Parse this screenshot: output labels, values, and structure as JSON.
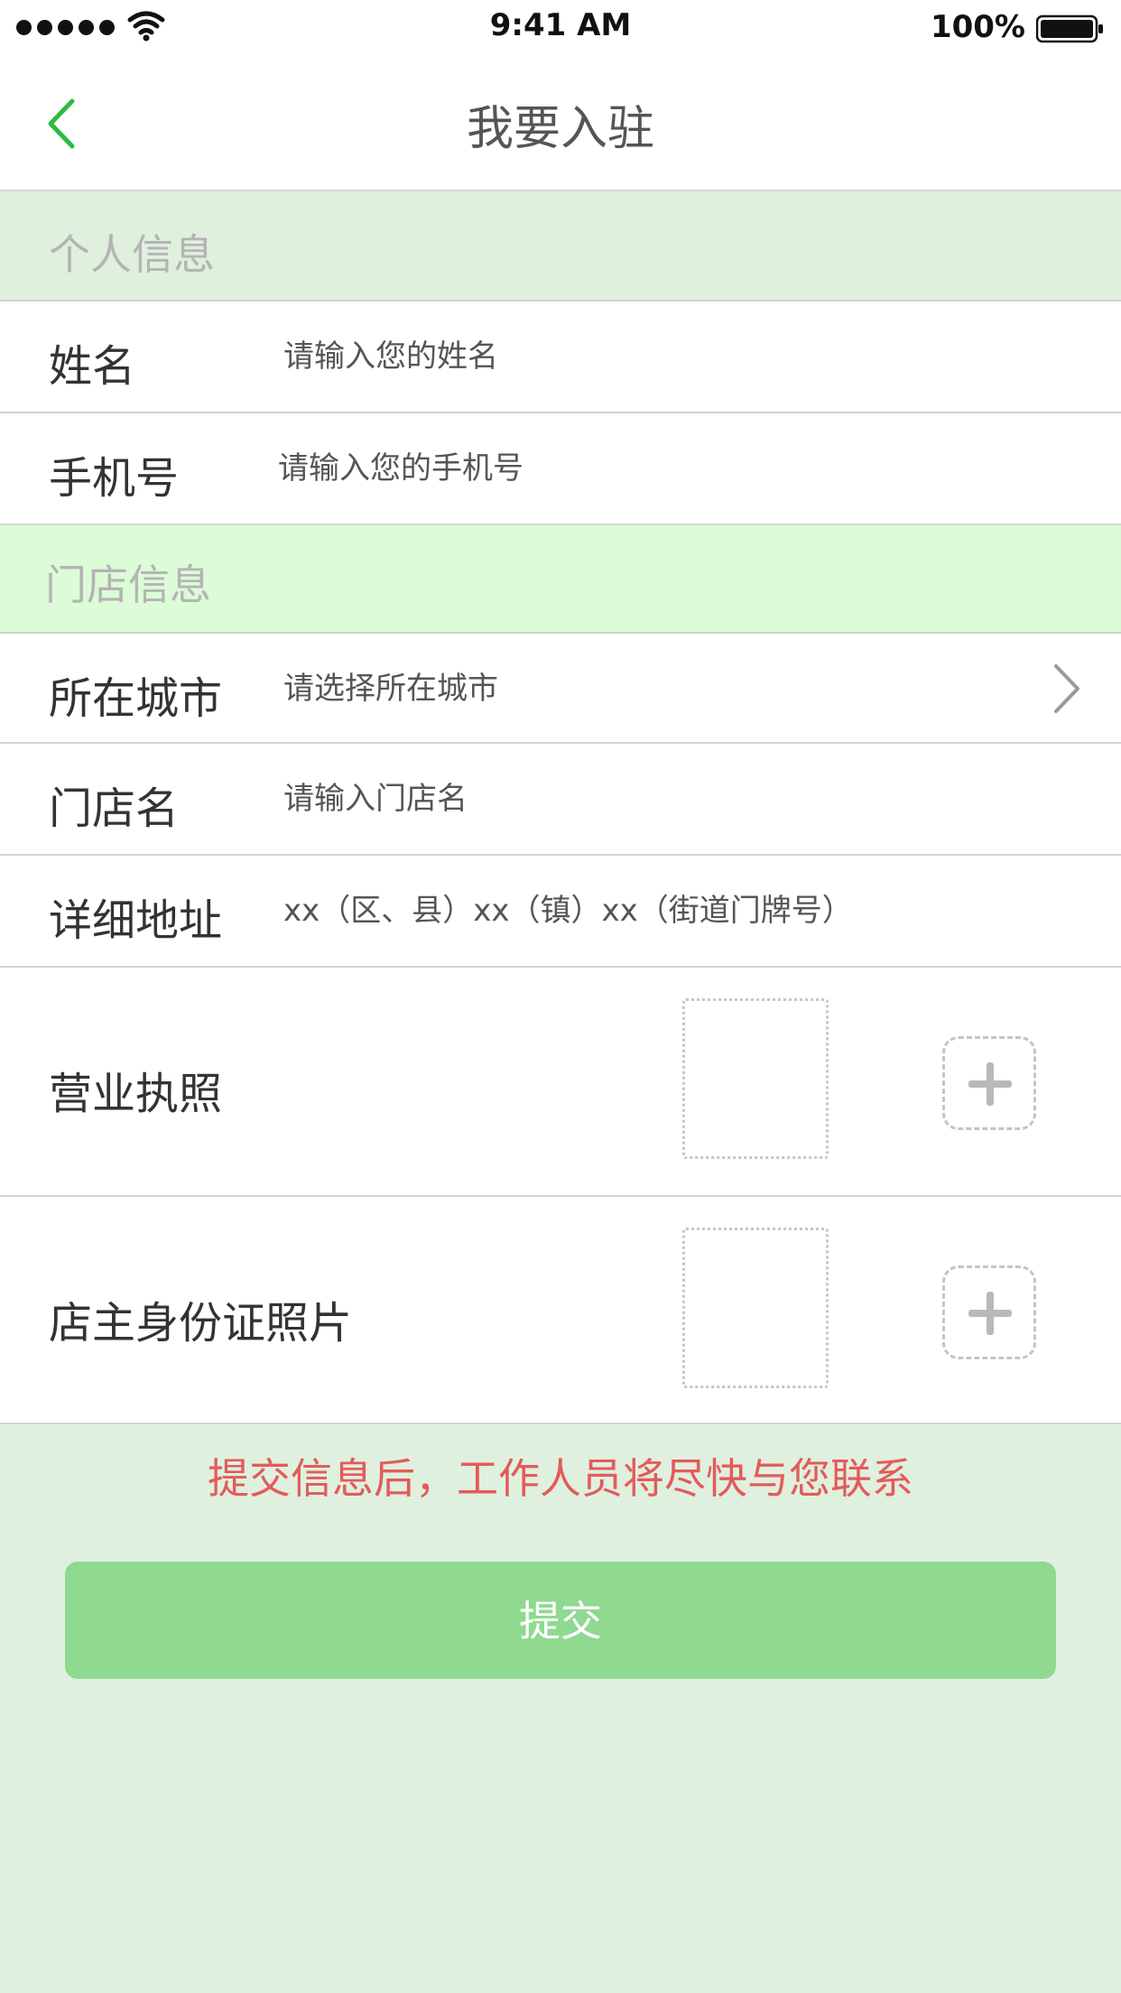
{
  "status_bar": {
    "time": "9:41 AM",
    "battery": "100%",
    "icons": [
      "signal-dots",
      "wifi-icon",
      "battery-icon"
    ]
  },
  "nav": {
    "title": "我要入驻",
    "back_icon": "chevron-left-icon"
  },
  "sections": {
    "personal": "个人信息",
    "store": "门店信息"
  },
  "form": {
    "name": {
      "label": "姓名",
      "placeholder": "请输入您的姓名"
    },
    "phone": {
      "label": "手机号",
      "placeholder": "请输入您的手机号"
    },
    "city": {
      "label": "所在城市",
      "placeholder": "请选择所在城市",
      "icon": "chevron-right-icon"
    },
    "store_name": {
      "label": "门店名",
      "placeholder": "请输入门店名"
    },
    "address": {
      "label": "详细地址",
      "placeholder": "xx（区、县）xx（镇）xx（街道门牌号）"
    },
    "license": {
      "label": "营业执照",
      "add_icon": "plus-icon"
    },
    "idcard": {
      "label": "店主身份证照片",
      "add_icon": "plus-icon"
    }
  },
  "notice": "提交信息后，工作人员将尽快与您联系",
  "submit_label": "提交",
  "colors": {
    "accent": "#8fd990",
    "back_icon": "#2dbb3f",
    "notice": "#e35b5b",
    "section_personal_bg": "#dff0dd",
    "section_store_bg": "#dcfbd7",
    "page_bg": "#e0f0de"
  }
}
